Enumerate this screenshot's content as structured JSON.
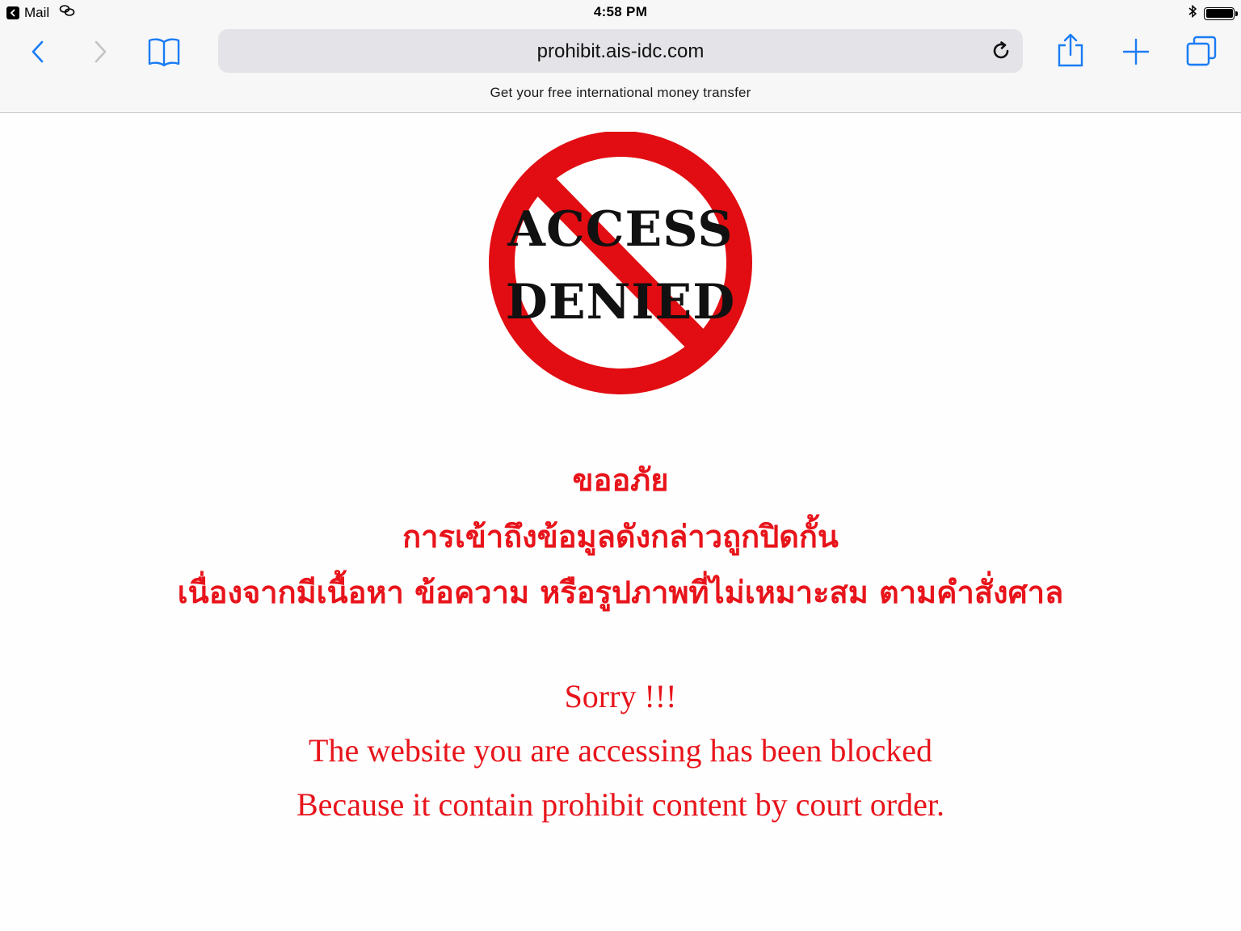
{
  "status_bar": {
    "back_app": "Mail",
    "time": "4:58 PM"
  },
  "toolbar": {
    "url": "prohibit.ais-idc.com",
    "banner": "Get your free international money transfer"
  },
  "page": {
    "sign_top_word": "ACCESS",
    "sign_bottom_word": "DENIED",
    "thai_title": "ขออภัย",
    "thai_line_1": "การเข้าถึงข้อมูลดังกล่าวถูกปิดกั้น",
    "thai_line_2": "เนื่องจากมีเนื้อหา ข้อความ หรือรูปภาพที่ไม่เหมาะสม ตามคำสั่งศาล",
    "en_title": "Sorry !!!",
    "en_line_1": "The website you are accessing has been blocked",
    "en_line_2": "Because it contain prohibit content by court order."
  },
  "colors": {
    "accent": "#1a7cf4",
    "warning_red": "#e8141b",
    "toolbar_bg": "#f7f7f7"
  },
  "icons": [
    "back-chevron-icon",
    "forward-chevron-icon",
    "bookmarks-icon",
    "reload-icon",
    "share-icon",
    "new-tab-icon",
    "tabs-icon",
    "link-icon",
    "bluetooth-icon",
    "battery-icon"
  ]
}
